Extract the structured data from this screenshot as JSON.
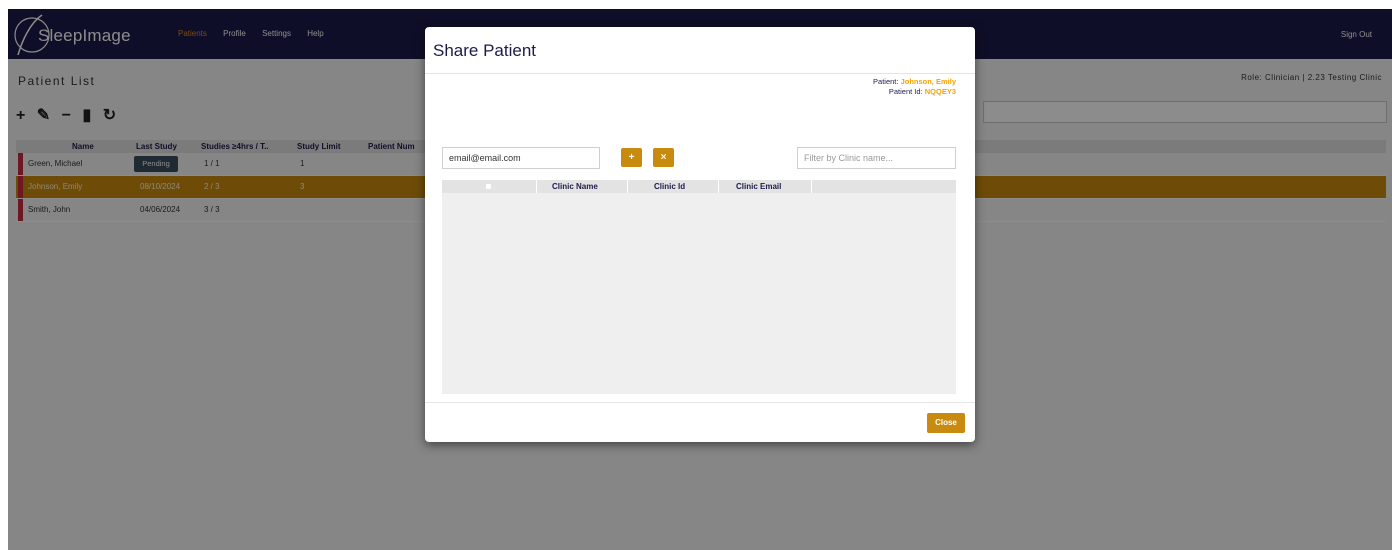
{
  "app": {
    "logo_text": "SleepImage",
    "nav": [
      "Patients",
      "Profile",
      "Settings",
      "Help"
    ],
    "sign_out": "Sign Out"
  },
  "page": {
    "title": "Patient List",
    "role": "Role: Clinician | 2.23 Testing Clinic",
    "toolbar_icons": [
      "plus-icon",
      "edit-icon",
      "minus-icon",
      "chart-icon",
      "refresh-icon"
    ],
    "columns": [
      "Name",
      "Last Study",
      "Studies ≥4hrs / T..",
      "Study Limit",
      "Patient Num"
    ],
    "rows": [
      {
        "name": "Green, Michael",
        "last_study": "Pending",
        "studies": "1 / 1",
        "limit": "1"
      },
      {
        "name": "Johnson, Emily",
        "last_study": "08/10/2024",
        "studies": "2 / 3",
        "limit": "3"
      },
      {
        "name": "Smith, John",
        "last_study": "04/06/2024",
        "studies": "3 / 3",
        "limit": ""
      }
    ]
  },
  "modal": {
    "title": "Share Patient",
    "patient_label": "Patient:",
    "patient_name": "Johnson, Emily",
    "patient_id_label": "Patient Id:",
    "patient_id": "NQQEY3",
    "email_value": "email@email.com",
    "add_label": "+",
    "remove_label": "×",
    "filter_placeholder": "Filter by Clinic name...",
    "columns": [
      "Clinic Name",
      "Clinic Id",
      "Clinic Email"
    ],
    "close_label": "Close"
  },
  "colors": {
    "nav_bg": "#1d1b4a",
    "accent": "#c98a10",
    "highlight": "#f5a300",
    "flag": "#c72a3f"
  }
}
